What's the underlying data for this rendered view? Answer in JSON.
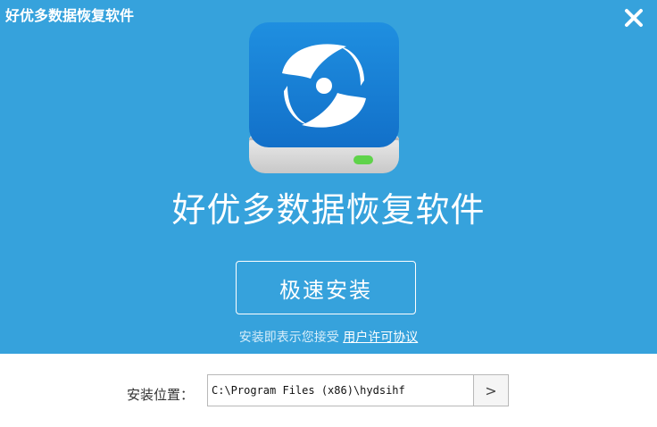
{
  "window": {
    "title": "好优多数据恢复软件",
    "close_icon": "close-icon"
  },
  "app": {
    "icon": "disc-drive-icon",
    "name": "好优多数据恢复软件"
  },
  "actions": {
    "install_label": "极速安装",
    "agree_text": "安装即表示您接受",
    "license_link": "用户许可协议"
  },
  "install_location": {
    "label": "安装位置：",
    "path": "C:\\Program Files (x86)\\hydsihf",
    "browse_label": ">"
  },
  "colors": {
    "header_bg": "#36a2dc",
    "text_on_header": "#ffffff"
  }
}
